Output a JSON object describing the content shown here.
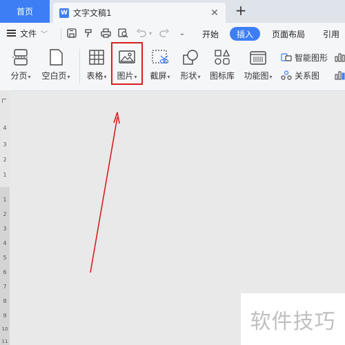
{
  "tabs": {
    "home_label": "首页",
    "doc_icon_letter": "W",
    "doc_title": "文字文稿1",
    "close_glyph": "✕",
    "new_tab_glyph": "+"
  },
  "menubar": {
    "file_label": "文件",
    "tabs": [
      {
        "label": "开始",
        "active": false
      },
      {
        "label": "插入",
        "active": true
      },
      {
        "label": "页面布局",
        "active": false
      },
      {
        "label": "引用",
        "active": false
      }
    ],
    "quick_access": [
      "save-icon",
      "format-painter-icon",
      "print-icon",
      "print-preview-icon",
      "undo-icon",
      "redo-icon",
      "customize-dropdown-icon"
    ]
  },
  "ribbon": {
    "items": [
      {
        "label": "分页",
        "dropdown": true
      },
      {
        "label": "空白页",
        "dropdown": true
      },
      {
        "label": "表格",
        "dropdown": true
      },
      {
        "label": "图片",
        "dropdown": true
      },
      {
        "label": "截屏",
        "dropdown": true
      },
      {
        "label": "形状",
        "dropdown": true
      },
      {
        "label": "图标库",
        "dropdown": false
      },
      {
        "label": "功能图",
        "dropdown": true
      }
    ],
    "small_items": [
      {
        "label": "智能图形"
      },
      {
        "label": "关系图"
      }
    ],
    "dropdown_glyph": "▾"
  },
  "ruler": {
    "top_numbers": [
      "4",
      "3",
      "2",
      "1"
    ],
    "bottom_numbers": [
      "1",
      "2",
      "3",
      "4",
      "5",
      "6",
      "7",
      "8",
      "9",
      "10",
      "11"
    ]
  },
  "watermark": {
    "text": "软件技巧"
  },
  "colors": {
    "accent": "#3e7ef5",
    "highlight": "#d61e1e",
    "arrow": "#d61e1e"
  }
}
